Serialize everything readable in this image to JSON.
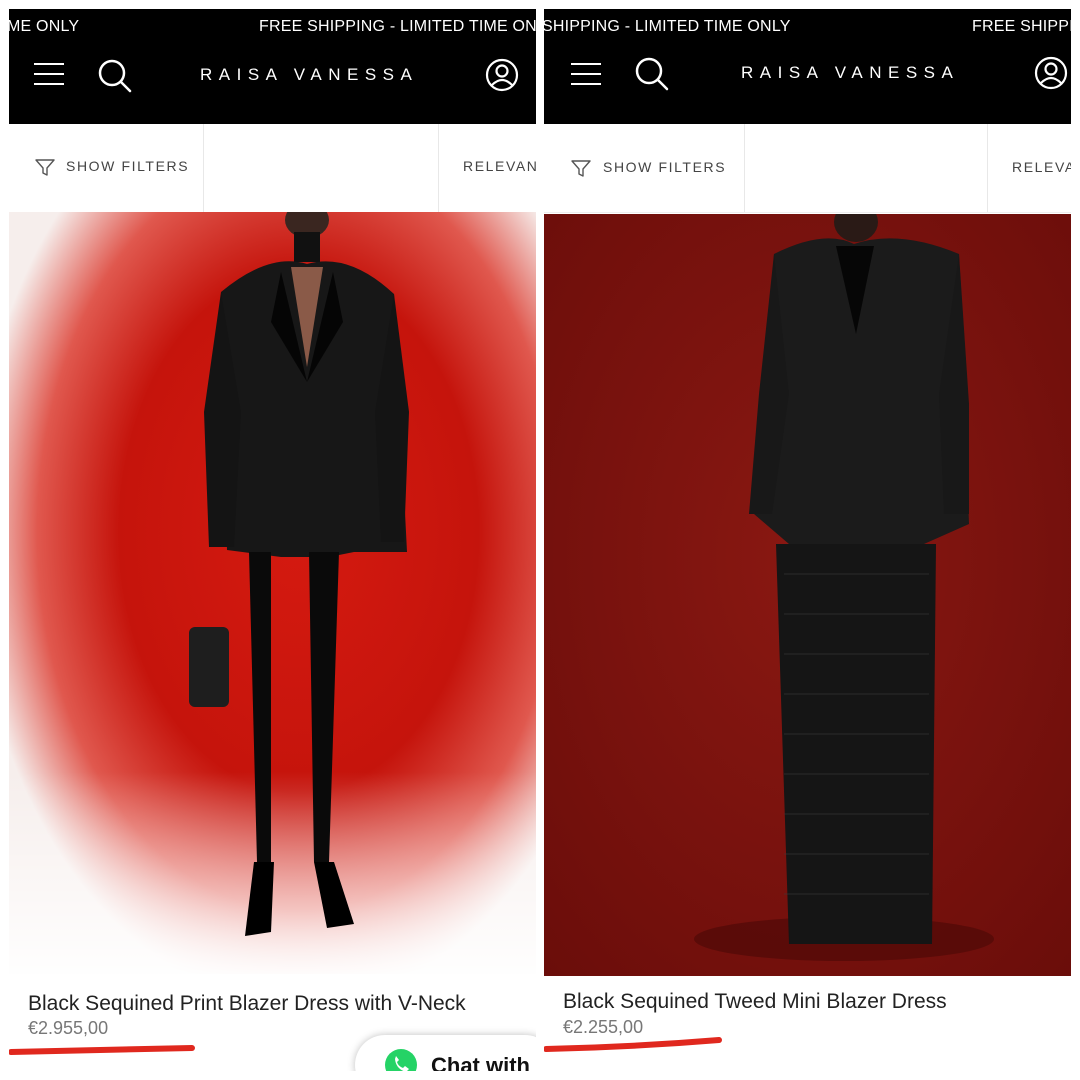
{
  "panels": [
    {
      "ticker_left": "ME ONLY",
      "ticker_right": "FREE SHIPPING - LIMITED TIME ONLY",
      "brand": "RAISA VANESSA",
      "filter_label": "SHOW FILTERS",
      "sort_label": "RELEVANC",
      "product_name": "Black Sequined Print Blazer Dress with V-Neck",
      "price": "€2.955,00"
    },
    {
      "ticker_left": "SHIPPING - LIMITED TIME ONLY",
      "ticker_right": "FREE SHIPPIN",
      "brand": "RAISA VANESSA",
      "filter_label": "SHOW FILTERS",
      "sort_label": "RELEVA",
      "product_name": "Black Sequined Tweed Mini Blazer Dress",
      "price": "€2.255,00"
    }
  ],
  "chat": {
    "label": "Chat with"
  },
  "icons": {
    "menu": "hamburger-menu-icon",
    "search": "search-icon",
    "account": "account-icon",
    "filter": "filter-funnel-icon",
    "chat": "whatsapp-icon"
  },
  "colors": {
    "header_bg": "#000000",
    "header_text": "#ffffff",
    "annotation_underline": "#e0281e",
    "whatsapp_green": "#25d366"
  }
}
